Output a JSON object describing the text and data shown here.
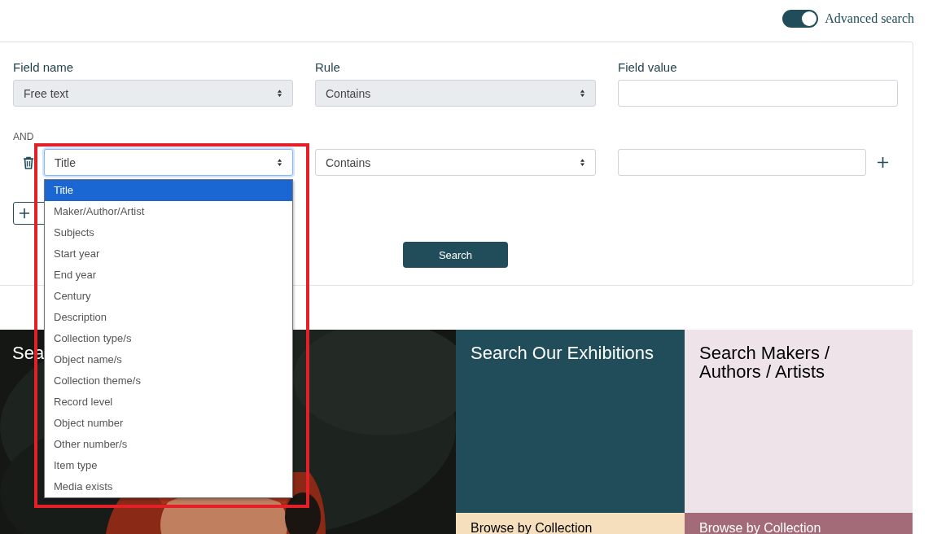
{
  "advanced_search": {
    "label": "Advanced search",
    "on": true
  },
  "form": {
    "headers": [
      "Field name",
      "Rule",
      "Field value"
    ],
    "rows": [
      {
        "field": "Free text",
        "rule": "Contains",
        "disabled": true,
        "focused": false
      },
      {
        "connector": "AND",
        "field": "Title",
        "rule": "Contains",
        "disabled": false,
        "focused": true
      }
    ],
    "dropdown": [
      {
        "label": "Title",
        "selected": true
      },
      {
        "label": "Maker/Author/Artist",
        "selected": false
      },
      {
        "label": "Subjects",
        "selected": false
      },
      {
        "label": "Start year",
        "selected": false
      },
      {
        "label": "End year",
        "selected": false
      },
      {
        "label": "Century",
        "selected": false
      },
      {
        "label": "Description",
        "selected": false
      },
      {
        "label": "Collection type/s",
        "selected": false
      },
      {
        "label": "Object name/s",
        "selected": false
      },
      {
        "label": "Collection theme/s",
        "selected": false
      },
      {
        "label": "Record level",
        "selected": false
      },
      {
        "label": "Object number",
        "selected": false
      },
      {
        "label": "Other number/s",
        "selected": false
      },
      {
        "label": "Item type",
        "selected": false
      },
      {
        "label": "Media exists",
        "selected": false
      }
    ],
    "search_button": "Search"
  },
  "tiles": [
    {
      "title": "Sea",
      "kind": "picture"
    },
    {
      "title": "Search Our Exhibitions",
      "kind": "color",
      "color": "#214d5a"
    },
    {
      "title": "Search Makers / Authors / Artists",
      "kind": "color",
      "color": "#efe3ea"
    },
    {
      "title": "Browse by Collection",
      "kind": "color",
      "color": "#f5dfbd"
    },
    {
      "title": "Browse by Collection",
      "kind": "color",
      "color": "#a36a78"
    }
  ]
}
